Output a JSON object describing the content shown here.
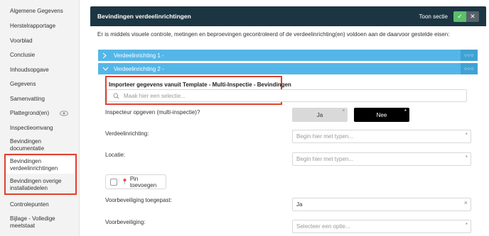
{
  "sidebar": {
    "items": [
      {
        "label": "Algemene Gegevens"
      },
      {
        "label": "Herstelrapportage"
      },
      {
        "label": "Voorblad"
      },
      {
        "label": "Conclusie"
      },
      {
        "label": "Inhoudsopgave"
      },
      {
        "label": "Gegevens"
      },
      {
        "label": "Samenvatting"
      },
      {
        "label": "Plattegrond(en)"
      },
      {
        "label": "Inspectieomvang"
      },
      {
        "label": "Bevindingen documentatie"
      },
      {
        "label": "Bevindingen verdeelinrichtingen"
      },
      {
        "label": "Bevindingen overige installatiedelen"
      },
      {
        "label": "Controlepunten"
      },
      {
        "label": "Bijlage - Volledige meetstaat"
      }
    ]
  },
  "section": {
    "title": "Bevindingen verdeelinrichtingen",
    "toon_label": "Toon sectie",
    "toggle_on": "✓",
    "toggle_off": "✕",
    "intro": "Er is middels visuele controle, metingen en beproevingen gecontroleerd of de verdeelinrichting(en) voldoen aan de daarvoor gestelde eisen:"
  },
  "accordions": [
    {
      "label": "Verdeelinrichting 1 -",
      "expanded": false
    },
    {
      "label": "Verdeelinrichting 2 -",
      "expanded": true
    }
  ],
  "dots": "○○○",
  "import": {
    "label": "Importeer gegevens vanuit Template - Multi-Inspectie - Bevindingen",
    "placeholder": "Maak hier een selectie..."
  },
  "fields": {
    "inspecteur_label": "Inspecteur opgeven (multi-inspectie)?",
    "ja": "Ja",
    "nee": "Nee",
    "verdeelinrichting_label": "Verdeelinrichting:",
    "verdeelinrichting_placeholder": "Begin hier met typen...",
    "locatie_label": "Locatie:",
    "locatie_placeholder": "Begin hier met typen...",
    "pin_label": "Pin toevoegen",
    "voorbeveiliging_toegepast_label": "Voorbeveiliging toegepast:",
    "voorbeveiliging_toegepast_value": "Ja",
    "voorbeveiliging_label": "Voorbeveiliging:",
    "voorbeveiliging_placeholder": "Selecteer een optie...",
    "required_mark": "*",
    "clear_mark": "×"
  }
}
